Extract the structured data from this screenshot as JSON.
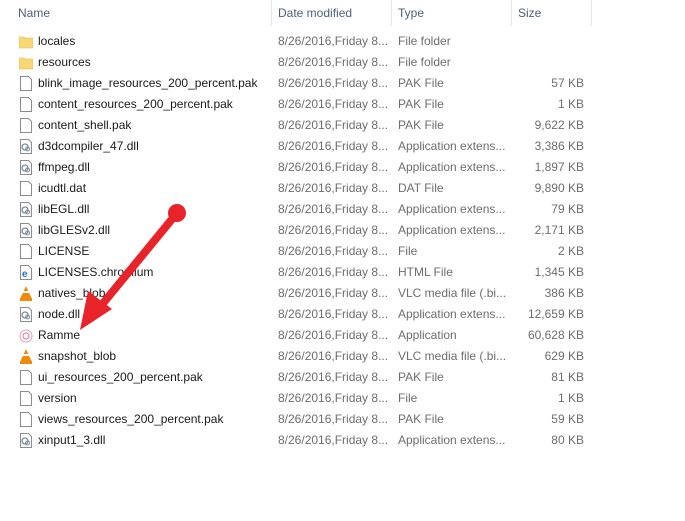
{
  "columns": {
    "name": "Name",
    "date": "Date modified",
    "type": "Type",
    "size": "Size"
  },
  "annotation_color": "#e8232a",
  "files": [
    {
      "name": "locales",
      "date": "8/26/2016,Friday 8...",
      "type": "File folder",
      "size": "",
      "icon": "folder"
    },
    {
      "name": "resources",
      "date": "8/26/2016,Friday 8...",
      "type": "File folder",
      "size": "",
      "icon": "folder"
    },
    {
      "name": "blink_image_resources_200_percent.pak",
      "date": "8/26/2016,Friday 8...",
      "type": "PAK File",
      "size": "57 KB",
      "icon": "file"
    },
    {
      "name": "content_resources_200_percent.pak",
      "date": "8/26/2016,Friday 8...",
      "type": "PAK File",
      "size": "1 KB",
      "icon": "file"
    },
    {
      "name": "content_shell.pak",
      "date": "8/26/2016,Friday 8...",
      "type": "PAK File",
      "size": "9,622 KB",
      "icon": "file"
    },
    {
      "name": "d3dcompiler_47.dll",
      "date": "8/26/2016,Friday 8...",
      "type": "Application extens...",
      "size": "3,386 KB",
      "icon": "dll"
    },
    {
      "name": "ffmpeg.dll",
      "date": "8/26/2016,Friday 8...",
      "type": "Application extens...",
      "size": "1,897 KB",
      "icon": "dll"
    },
    {
      "name": "icudtl.dat",
      "date": "8/26/2016,Friday 8...",
      "type": "DAT File",
      "size": "9,890 KB",
      "icon": "file"
    },
    {
      "name": "libEGL.dll",
      "date": "8/26/2016,Friday 8...",
      "type": "Application extens...",
      "size": "79 KB",
      "icon": "dll"
    },
    {
      "name": "libGLESv2.dll",
      "date": "8/26/2016,Friday 8...",
      "type": "Application extens...",
      "size": "2,171 KB",
      "icon": "dll"
    },
    {
      "name": "LICENSE",
      "date": "8/26/2016,Friday 8...",
      "type": "File",
      "size": "2 KB",
      "icon": "file"
    },
    {
      "name": "LICENSES.chromium",
      "date": "8/26/2016,Friday 8...",
      "type": "HTML File",
      "size": "1,345 KB",
      "icon": "html"
    },
    {
      "name": "natives_blob",
      "date": "8/26/2016,Friday 8...",
      "type": "VLC media file (.bi...",
      "size": "386 KB",
      "icon": "vlc"
    },
    {
      "name": "node.dll",
      "date": "8/26/2016,Friday 8...",
      "type": "Application extens...",
      "size": "12,659 KB",
      "icon": "dll"
    },
    {
      "name": "Ramme",
      "date": "8/26/2016,Friday 8...",
      "type": "Application",
      "size": "60,628 KB",
      "icon": "app"
    },
    {
      "name": "snapshot_blob",
      "date": "8/26/2016,Friday 8...",
      "type": "VLC media file (.bi...",
      "size": "629 KB",
      "icon": "vlc"
    },
    {
      "name": "ui_resources_200_percent.pak",
      "date": "8/26/2016,Friday 8...",
      "type": "PAK File",
      "size": "81 KB",
      "icon": "file"
    },
    {
      "name": "version",
      "date": "8/26/2016,Friday 8...",
      "type": "File",
      "size": "1 KB",
      "icon": "file"
    },
    {
      "name": "views_resources_200_percent.pak",
      "date": "8/26/2016,Friday 8...",
      "type": "PAK File",
      "size": "59 KB",
      "icon": "file"
    },
    {
      "name": "xinput1_3.dll",
      "date": "8/26/2016,Friday 8...",
      "type": "Application extens...",
      "size": "80 KB",
      "icon": "dll"
    }
  ]
}
